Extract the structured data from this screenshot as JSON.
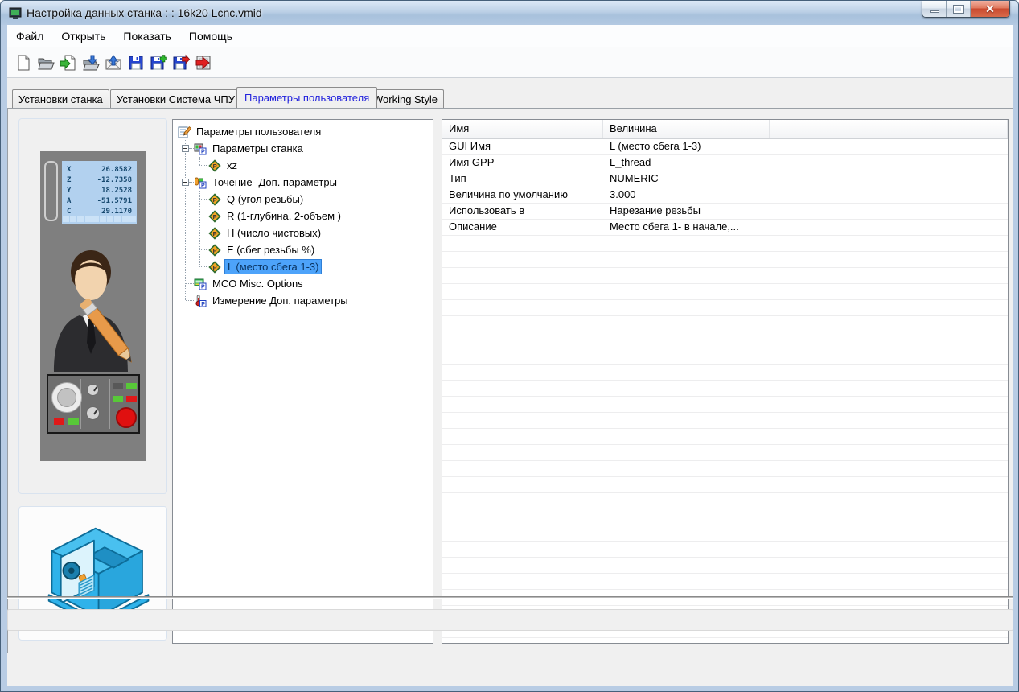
{
  "window": {
    "title": "Настройка данных станка : : 16k20 Lcnc.vmid"
  },
  "menu": {
    "items": [
      "Файл",
      "Открыть",
      "Показать",
      "Помощь"
    ]
  },
  "toolbar": {
    "buttons": [
      "new-document",
      "open-folder",
      "import-file",
      "load-into-folder",
      "mail-receive",
      "save",
      "save-add",
      "save-export",
      "exit"
    ]
  },
  "tabs": {
    "items": [
      {
        "label": "Установки станка"
      },
      {
        "label": "Установки Система ЧПУ"
      },
      {
        "label": "Параметры пользователя",
        "active": true
      },
      {
        "label": "Working Style"
      }
    ]
  },
  "dro": {
    "rows": [
      {
        "axis": "X",
        "value": "26.8582"
      },
      {
        "axis": "Z",
        "value": "-12.7358"
      },
      {
        "axis": "Y",
        "value": "18.2528"
      },
      {
        "axis": "A",
        "value": "-51.5791"
      },
      {
        "axis": "C",
        "value": "29.1170"
      }
    ]
  },
  "tree": {
    "items": [
      {
        "label": "Параметры пользователя",
        "depth": 0,
        "icon": "notepad-pencil"
      },
      {
        "label": "Параметры станка",
        "depth": 1,
        "icon": "machine-params",
        "expanded": true
      },
      {
        "label": "xz",
        "depth": 2,
        "icon": "param-diamond"
      },
      {
        "label": "Точение- Доп. параметры",
        "depth": 1,
        "icon": "turning-params",
        "expanded": true
      },
      {
        "label": "Q (угол резьбы)",
        "depth": 2,
        "icon": "param-diamond"
      },
      {
        "label": "R (1-глубина. 2-объем )",
        "depth": 2,
        "icon": "param-diamond"
      },
      {
        "label": "H (число чистовых)",
        "depth": 2,
        "icon": "param-diamond"
      },
      {
        "label": "E (сбег резьбы %)",
        "depth": 2,
        "icon": "param-diamond"
      },
      {
        "label": "L (место сбега 1-3)",
        "depth": 2,
        "icon": "param-diamond",
        "selected": true
      },
      {
        "label": "MCO Misc. Options",
        "depth": 1,
        "icon": "mco-options"
      },
      {
        "label": "Измерение Доп. параметры",
        "depth": 1,
        "icon": "measure-params"
      }
    ]
  },
  "table": {
    "columns": [
      "Имя",
      "Величина"
    ],
    "rows": [
      {
        "name": "GUI Имя",
        "value": "L (место сбега 1-3)"
      },
      {
        "name": "Имя GPP",
        "value": "L_thread"
      },
      {
        "name": "Тип",
        "value": "NUMERIC"
      },
      {
        "name": "Величина по умолчанию",
        "value": "3.000"
      },
      {
        "name": "Использовать в",
        "value": "Нарезание резьбы"
      },
      {
        "name": "Описание",
        "value": "Место сбега 1- в начале,..."
      }
    ]
  }
}
